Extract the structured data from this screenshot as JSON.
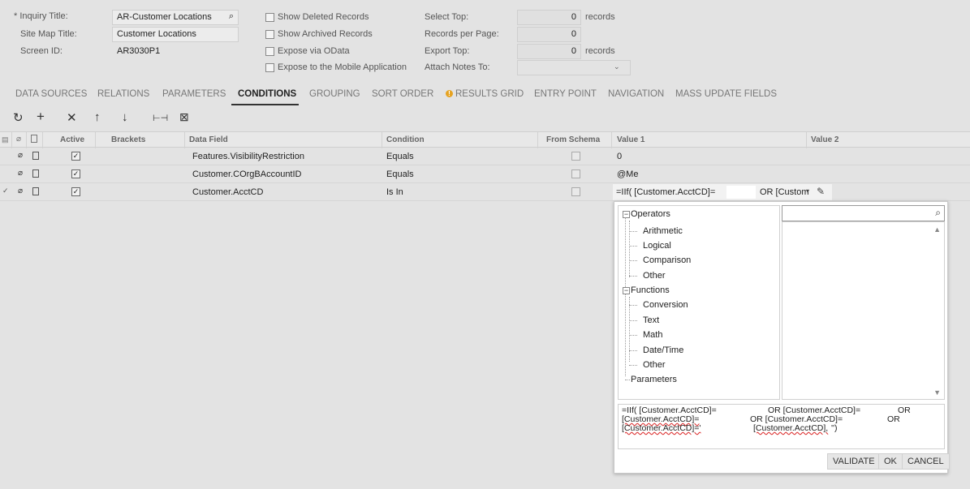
{
  "form": {
    "inquiry_title_label": "* Inquiry Title:",
    "inquiry_title_value": "AR-Customer Locations",
    "site_map_title_label": "Site Map Title:",
    "site_map_title_value": "Customer Locations",
    "screen_id_label": "Screen ID:",
    "screen_id_value": "AR3030P1",
    "show_deleted_label": "Show Deleted Records",
    "show_archived_label": "Show Archived Records",
    "expose_odata_label": "Expose via OData",
    "expose_mobile_label": "Expose to the Mobile Application",
    "select_top_label": "Select Top:",
    "select_top_value": "0",
    "records_per_page_label": "Records per Page:",
    "records_per_page_value": "0",
    "export_top_label": "Export Top:",
    "export_top_value": "0",
    "attach_notes_label": "Attach Notes To:",
    "attach_notes_value": "",
    "records_suffix": "records"
  },
  "tabs": [
    {
      "label": "DATA SOURCES"
    },
    {
      "label": "RELATIONS"
    },
    {
      "label": "PARAMETERS"
    },
    {
      "label": "CONDITIONS",
      "active": true
    },
    {
      "label": "GROUPING"
    },
    {
      "label": "SORT ORDER"
    },
    {
      "label": "RESULTS GRID",
      "warning": true
    },
    {
      "label": "ENTRY POINT"
    },
    {
      "label": "NAVIGATION"
    },
    {
      "label": "MASS UPDATE FIELDS"
    }
  ],
  "toolbar": {
    "refresh_glyph": "↻",
    "add_glyph": "+",
    "delete_glyph": "✕",
    "up_glyph": "↑",
    "down_glyph": "↓",
    "fit_glyph": "⊢⊣",
    "export_glyph": "⊠"
  },
  "grid": {
    "columns": [
      "Active",
      "Brackets",
      "Data Field",
      "Condition",
      "From Schema",
      "Value 1",
      "Value 2"
    ],
    "rows": [
      {
        "active": true,
        "brackets": "",
        "data_field": "Features.VisibilityRestriction",
        "condition": "Equals",
        "from_schema": false,
        "value1": "0",
        "value2": ""
      },
      {
        "active": true,
        "brackets": "",
        "data_field": "Customer.COrgBAccountID",
        "condition": "Equals",
        "from_schema": false,
        "value1": "@Me",
        "value2": ""
      },
      {
        "active": true,
        "brackets": "",
        "data_field": "Customer.AcctCD",
        "condition": "Is In",
        "from_schema": false,
        "value1": "=IIf(   [Customer.AcctCD]=",
        "value1_tail": "OR [Custom",
        "value2": ""
      }
    ]
  },
  "editor": {
    "tree": {
      "operators": "Operators",
      "arithmetic": "Arithmetic",
      "logical": "Logical",
      "comparison": "Comparison",
      "other1": "Other",
      "functions": "Functions",
      "conversion": "Conversion",
      "text": "Text",
      "math": "Math",
      "datetime": "Date/Time",
      "other2": "Other",
      "parameters": "Parameters"
    },
    "search_placeholder": "",
    "formula_line1a": "=IIf(   [Customer.AcctCD]=",
    "formula_line1b": "OR [Customer.AcctCD]=",
    "formula_line1c": "OR",
    "formula_line2a": "[Customer.AcctCD]=",
    "formula_line2b": "OR [Customer.AcctCD]=",
    "formula_line2c": "OR",
    "formula_line3a": "[Customer.AcctCD]='",
    "formula_line3b": "[Customer.AcctCD],",
    "formula_line3c": "'')",
    "validate_label": "VALIDATE",
    "ok_label": "OK",
    "cancel_label": "CANCEL"
  }
}
